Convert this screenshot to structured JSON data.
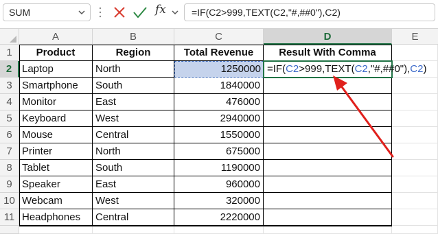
{
  "formula_bar": {
    "name_box": "SUM",
    "icons": [
      "chevron-down-icon",
      "cancel-icon",
      "enter-icon",
      "fx-icon"
    ],
    "formula": "=IF(C2>999,TEXT(C2,\"#,##0\"),C2)"
  },
  "grid": {
    "columns": [
      "A",
      "B",
      "C",
      "D",
      "E"
    ],
    "rows": [
      "1",
      "2",
      "3",
      "4",
      "5",
      "6",
      "7",
      "8",
      "9",
      "10",
      "11"
    ],
    "active_column": "D",
    "active_row": "2",
    "headers": [
      "Product",
      "Region",
      "Total Revenue",
      "Result With Comma"
    ],
    "data": [
      [
        "Laptop",
        "North",
        "1250000"
      ],
      [
        "Smartphone",
        "South",
        "1840000"
      ],
      [
        "Monitor",
        "East",
        "476000"
      ],
      [
        "Keyboard",
        "West",
        "2940000"
      ],
      [
        "Mouse",
        "Central",
        "1550000"
      ],
      [
        "Printer",
        "North",
        "675000"
      ],
      [
        "Tablet",
        "South",
        "1190000"
      ],
      [
        "Speaker",
        "East",
        "960000"
      ],
      [
        "Webcam",
        "West",
        "320000"
      ],
      [
        "Headphones",
        "Central",
        "2220000"
      ]
    ],
    "editing_cell": {
      "ref": "D2",
      "parts": [
        "=IF(",
        "C2",
        ">999,TEXT(",
        "C2",
        ",\"#,##0\"),",
        "C2",
        ")"
      ]
    }
  },
  "colors": {
    "accent_green": "#217346",
    "reference_blue": "#3b69c9",
    "arrow_red": "#e0201c",
    "selection_fill": "#c5d3ec"
  }
}
